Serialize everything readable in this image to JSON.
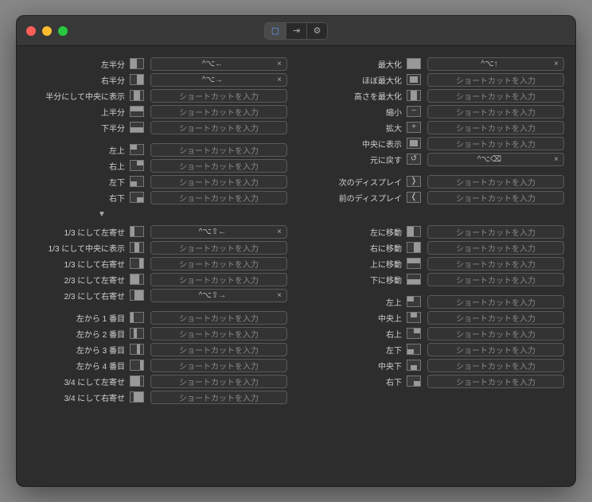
{
  "placeholder": "ショートカットを入力",
  "clear_glyph": "×",
  "disclosure_glyph": "▼",
  "toolbar": {
    "tab1": "▢",
    "tab2": "⇥",
    "tab3": "⚙"
  },
  "sections": {
    "topLeft": [
      {
        "name": "left-half",
        "label": "左半分",
        "icon": "left-half",
        "value": "^⌥←"
      },
      {
        "name": "right-half",
        "label": "右半分",
        "icon": "right-half",
        "value": "^⌥→"
      },
      {
        "name": "center-half",
        "label": "半分にして中央に表示",
        "icon": "mid-h",
        "value": null
      },
      {
        "name": "top-half",
        "label": "上半分",
        "icon": "top-half",
        "value": null
      },
      {
        "name": "bottom-half",
        "label": "下半分",
        "icon": "bottom-half",
        "value": null
      },
      {
        "spacer": true
      },
      {
        "name": "top-left",
        "label": "左上",
        "icon": "tl",
        "value": null
      },
      {
        "name": "top-right",
        "label": "右上",
        "icon": "tr",
        "value": null
      },
      {
        "name": "bottom-left",
        "label": "左下",
        "icon": "bl",
        "value": null
      },
      {
        "name": "bottom-right",
        "label": "右下",
        "icon": "br",
        "value": null
      }
    ],
    "topRight": [
      {
        "name": "maximize",
        "label": "最大化",
        "icon": "full",
        "value": "^⌥↑"
      },
      {
        "name": "almost-maximize",
        "label": "ほぼ最大化",
        "icon": "center",
        "value": null
      },
      {
        "name": "maximize-height",
        "label": "高さを最大化",
        "icon": "mid-h",
        "value": null
      },
      {
        "name": "smaller",
        "label": "縮小",
        "icon": "glyph",
        "glyph": "−",
        "value": null
      },
      {
        "name": "larger",
        "label": "拡大",
        "icon": "glyph",
        "glyph": "+",
        "value": null
      },
      {
        "name": "center",
        "label": "中央に表示",
        "icon": "center",
        "value": null
      },
      {
        "name": "restore",
        "label": "元に戻す",
        "icon": "glyph",
        "glyph": "↺",
        "value": "^⌥⌫"
      },
      {
        "spacer": true
      },
      {
        "name": "next-display",
        "label": "次のディスプレイ",
        "icon": "glyph",
        "glyph": "❭",
        "value": null
      },
      {
        "name": "prev-display",
        "label": "前のディスプレイ",
        "icon": "glyph",
        "glyph": "❬",
        "value": null
      }
    ],
    "bottomLeft": [
      {
        "name": "first-third",
        "label": "1/3 にして左寄せ",
        "icon": "left-third",
        "value": "^⌥⇧←"
      },
      {
        "name": "center-third",
        "label": "1/3 にして中央に表示",
        "icon": "mid-third",
        "value": null
      },
      {
        "name": "last-third",
        "label": "1/3 にして右寄せ",
        "icon": "right-third",
        "value": null
      },
      {
        "name": "first-two-thirds",
        "label": "2/3 にして左寄せ",
        "icon": "left-2third",
        "value": null
      },
      {
        "name": "last-two-thirds",
        "label": "2/3 にして右寄せ",
        "icon": "right-2third",
        "value": "^⌥⇧→"
      },
      {
        "spacer": true
      },
      {
        "name": "first-fourth",
        "label": "左から 1 番目",
        "icon": "q1",
        "value": null
      },
      {
        "name": "second-fourth",
        "label": "左から 2 番目",
        "icon": "q2",
        "value": null
      },
      {
        "name": "third-fourth",
        "label": "左から 3 番目",
        "icon": "q3",
        "value": null
      },
      {
        "name": "fourth-fourth",
        "label": "左から 4 番目",
        "icon": "q4",
        "value": null
      },
      {
        "name": "first-three-fourths",
        "label": "3/4 にして左寄せ",
        "icon": "left-3q",
        "value": null
      },
      {
        "name": "last-three-fourths",
        "label": "3/4 にして右寄せ",
        "icon": "right-3q",
        "value": null
      }
    ],
    "bottomRight": [
      {
        "name": "move-left",
        "label": "左に移動",
        "icon": "left-half",
        "value": null
      },
      {
        "name": "move-right",
        "label": "右に移動",
        "icon": "right-half",
        "value": null
      },
      {
        "name": "move-up",
        "label": "上に移動",
        "icon": "top-half",
        "value": null
      },
      {
        "name": "move-down",
        "label": "下に移動",
        "icon": "bottom-half",
        "value": null
      },
      {
        "spacer": true
      },
      {
        "name": "sixth-tl",
        "label": "左上",
        "icon": "tl",
        "value": null
      },
      {
        "name": "sixth-tc",
        "label": "中央上",
        "icon": "top-center",
        "value": null
      },
      {
        "name": "sixth-tr",
        "label": "右上",
        "icon": "tr",
        "value": null
      },
      {
        "name": "sixth-bl",
        "label": "左下",
        "icon": "bl",
        "value": null
      },
      {
        "name": "sixth-bc",
        "label": "中央下",
        "icon": "bot-center",
        "value": null
      },
      {
        "name": "sixth-br",
        "label": "右下",
        "icon": "br",
        "value": null
      }
    ]
  }
}
